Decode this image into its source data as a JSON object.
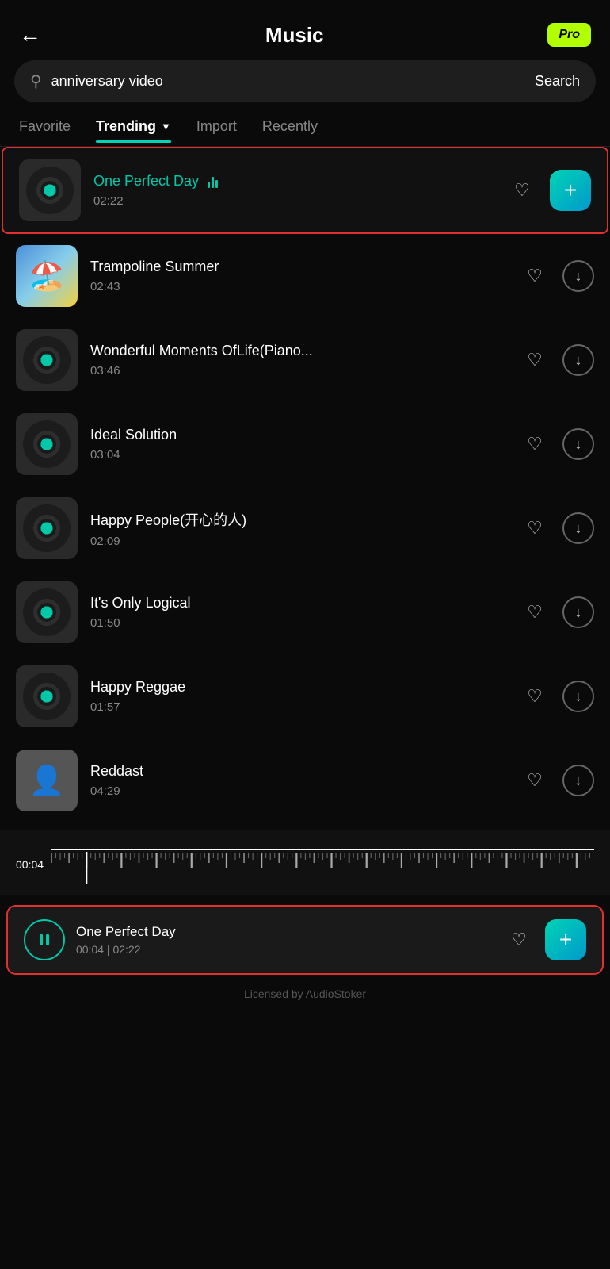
{
  "header": {
    "title": "Music",
    "back_label": "←",
    "pro_label": "Pro"
  },
  "search": {
    "placeholder": "anniversary video",
    "search_button_label": "Search"
  },
  "tabs": [
    {
      "id": "favorite",
      "label": "Favorite",
      "active": false
    },
    {
      "id": "trending",
      "label": "Trending",
      "active": true
    },
    {
      "id": "import",
      "label": "Import",
      "active": false
    },
    {
      "id": "recently",
      "label": "Recently",
      "active": false
    }
  ],
  "songs": [
    {
      "id": 1,
      "title": "One Perfect Day",
      "duration": "02:22",
      "selected": true,
      "playing": true,
      "thumb_type": "vinyl"
    },
    {
      "id": 2,
      "title": "Trampoline Summer",
      "duration": "02:43",
      "selected": false,
      "playing": false,
      "thumb_type": "beach"
    },
    {
      "id": 3,
      "title": "Wonderful Moments OfLife(Piano...",
      "duration": "03:46",
      "selected": false,
      "playing": false,
      "thumb_type": "vinyl"
    },
    {
      "id": 4,
      "title": "Ideal Solution",
      "duration": "03:04",
      "selected": false,
      "playing": false,
      "thumb_type": "vinyl"
    },
    {
      "id": 5,
      "title": "Happy People(开心的人)",
      "duration": "02:09",
      "selected": false,
      "playing": false,
      "thumb_type": "vinyl"
    },
    {
      "id": 6,
      "title": "It's Only Logical",
      "duration": "01:50",
      "selected": false,
      "playing": false,
      "thumb_type": "vinyl"
    },
    {
      "id": 7,
      "title": "Happy Reggae",
      "duration": "01:57",
      "selected": false,
      "playing": false,
      "thumb_type": "vinyl"
    },
    {
      "id": 8,
      "title": "Reddast",
      "duration": "04:29",
      "selected": false,
      "playing": false,
      "thumb_type": "person"
    }
  ],
  "timeline": {
    "current_time": "00:04"
  },
  "now_playing": {
    "title": "One Perfect Day",
    "time_display": "00:04 | 02:22"
  },
  "footer": {
    "license_text": "Licensed by AudioStoker"
  }
}
